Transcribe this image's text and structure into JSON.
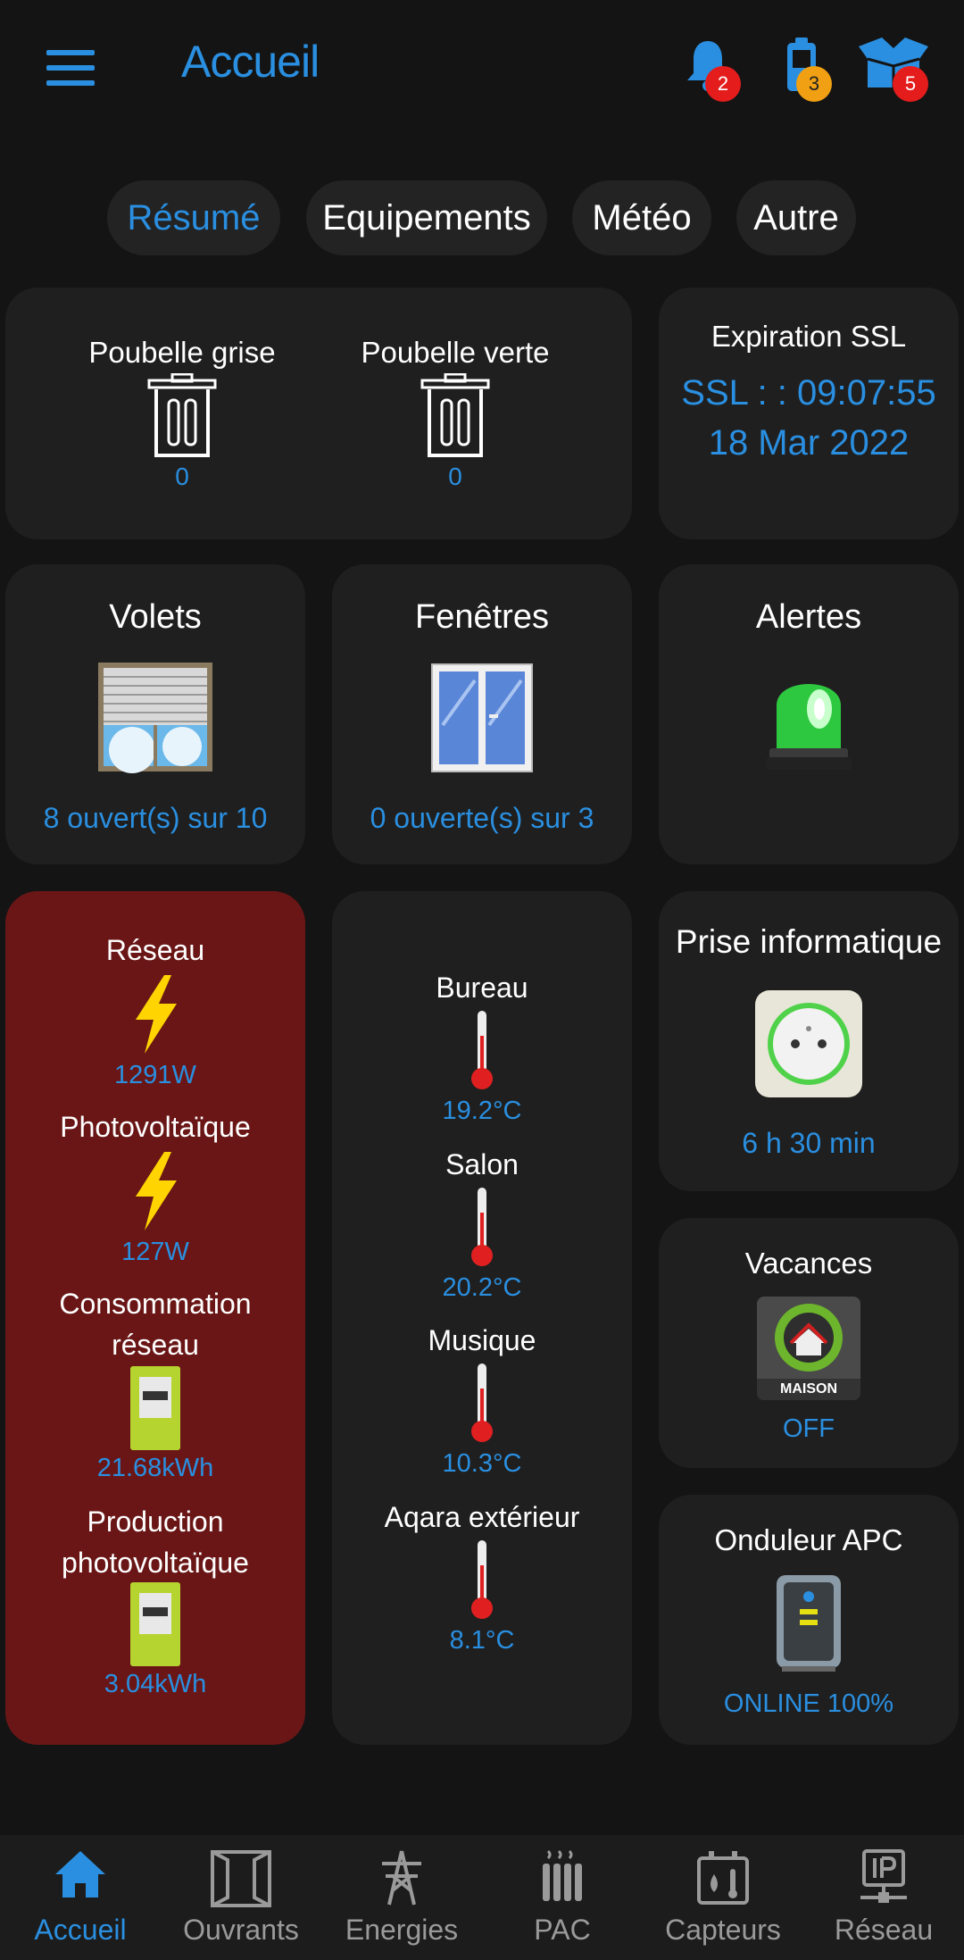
{
  "header": {
    "title": "Accueil",
    "notifications_badge": "2",
    "battery_badge": "3",
    "packages_badge": "5"
  },
  "tabs": [
    {
      "label": "Résumé",
      "active": true
    },
    {
      "label": "Equipements",
      "active": false
    },
    {
      "label": "Météo",
      "active": false
    },
    {
      "label": "Autre",
      "active": false
    }
  ],
  "poubelles": {
    "grise_label": "Poubelle grise",
    "grise_value": "0",
    "verte_label": "Poubelle verte",
    "verte_value": "0"
  },
  "ssl": {
    "title": "Expiration SSL",
    "line1": "SSL : : 09:07:55",
    "line2": "18 Mar 2022"
  },
  "volets": {
    "title": "Volets",
    "value": "8 ouvert(s) sur 10"
  },
  "fenetres": {
    "title": "Fenêtres",
    "value": "0 ouverte(s) sur 3"
  },
  "alertes": {
    "title": "Alertes"
  },
  "energie": {
    "reseau_label": "Réseau",
    "reseau_value": "1291W",
    "pv_label": "Photovoltaïque",
    "pv_value": "127W",
    "conso_label_1": "Consommation",
    "conso_label_2": "réseau",
    "conso_value": "21.68kWh",
    "prod_label_1": "Production",
    "prod_label_2": "photovoltaïque",
    "prod_value": "3.04kWh"
  },
  "temperatures": [
    {
      "label": "Bureau",
      "value": "19.2°C"
    },
    {
      "label": "Salon",
      "value": "20.2°C"
    },
    {
      "label": "Musique",
      "value": "10.3°C"
    },
    {
      "label": "Aqara extérieur",
      "value": "8.1°C"
    }
  ],
  "prise": {
    "title": "Prise informatique",
    "value": "6 h 30 min"
  },
  "vacances": {
    "title": "Vacances",
    "value": "OFF",
    "logo_text": "MAISON"
  },
  "onduleur": {
    "title": "Onduleur APC",
    "value": "ONLINE 100%"
  },
  "nav": [
    {
      "label": "Accueil",
      "icon": "home-icon",
      "active": true
    },
    {
      "label": "Ouvrants",
      "icon": "window-frame-icon",
      "active": false
    },
    {
      "label": "Energies",
      "icon": "power-pylon-icon",
      "active": false
    },
    {
      "label": "PAC",
      "icon": "radiator-icon",
      "active": false
    },
    {
      "label": "Capteurs",
      "icon": "sensors-icon",
      "active": false
    },
    {
      "label": "Réseau",
      "icon": "ip-network-icon",
      "active": false
    }
  ],
  "colors": {
    "accent": "#2a8fe0",
    "background": "#141414",
    "card": "#1f1f1f",
    "energy_card": "#6a1616",
    "badge_red": "#e51c1c",
    "badge_orange": "#f0a012"
  }
}
